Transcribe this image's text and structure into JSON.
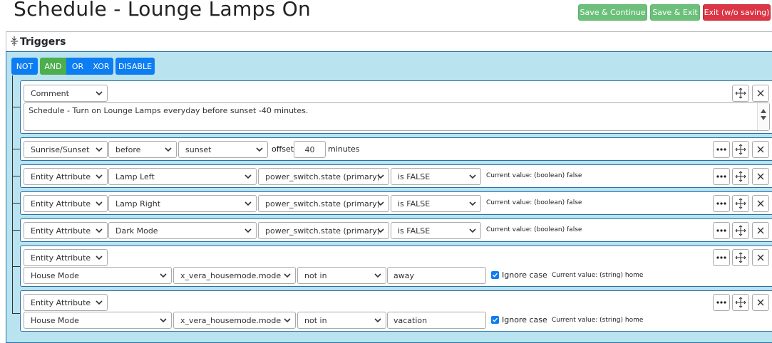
{
  "header": {
    "title": "Schedule - Lounge Lamps On",
    "save_continue": "Save & Continue",
    "save_exit": "Save & Exit",
    "exit_nosave": "Exit (w/o saving)"
  },
  "triggers": {
    "title": "Triggers",
    "ops": {
      "not": "NOT",
      "and": "AND",
      "or": "OR",
      "xor": "XOR",
      "disable": "DISABLE"
    }
  },
  "rows": {
    "comment": {
      "type": "Comment",
      "text": "Schedule - Turn on Lounge Lamps everyday before sunset -40 minutes."
    },
    "sun": {
      "type": "Sunrise/Sunset",
      "when": "before",
      "event": "sunset",
      "offset_label": "offset",
      "offset": "40",
      "unit": "minutes"
    },
    "lamp_left": {
      "type": "Entity Attribute",
      "entity": "Lamp Left",
      "attr": "power_switch.state (primary)",
      "op": "is FALSE",
      "current": "Current value: (boolean) false"
    },
    "lamp_right": {
      "type": "Entity Attribute",
      "entity": "Lamp Right",
      "attr": "power_switch.state (primary)",
      "op": "is FALSE",
      "current": "Current value: (boolean) false"
    },
    "dark_mode": {
      "type": "Entity Attribute",
      "entity": "Dark Mode",
      "attr": "power_switch.state (primary)",
      "op": "is FALSE",
      "current": "Current value: (boolean) false"
    },
    "house_away": {
      "type": "Entity Attribute",
      "entity": "House Mode",
      "attr": "x_vera_housemode.mode",
      "op": "not in",
      "value": "away",
      "ignore_case": "Ignore case",
      "current": "Current value: (string) home"
    },
    "house_vacation": {
      "type": "Entity Attribute",
      "entity": "House Mode",
      "attr": "x_vera_housemode.mode",
      "op": "not in",
      "value": "vacation",
      "ignore_case": "Ignore case",
      "current": "Current value: (string) home"
    }
  },
  "icons": {
    "more": "more-icon",
    "move": "move-icon",
    "close": "close-icon",
    "chevron": "chevron-down-icon",
    "collapse": "collapse-icon",
    "check": "check-icon"
  },
  "colors": {
    "primary": "#0d7df2",
    "success": "#6cc07a",
    "danger": "#dc3545",
    "panel": "#b9e3ef",
    "border": "#2a70a8"
  }
}
